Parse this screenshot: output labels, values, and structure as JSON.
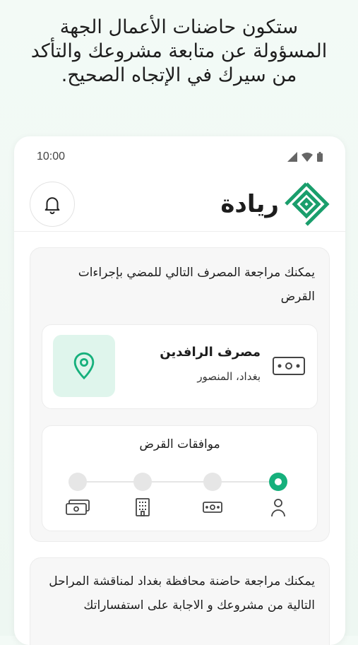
{
  "headline": "ستكون حاضنات الأعمال الجهة المسؤولة عن متابعة مشروعك والتأكد من سيرك في الإتجاه الصحيح.",
  "status": {
    "time": "10:00"
  },
  "app": {
    "logo_text": "ريادة"
  },
  "card1": {
    "intro": "يمكنك مراجعة المصرف التالي للمضي بإجراءات القرض",
    "bank_name": "مصرف الرافدين",
    "bank_location": "بغداد، المنصور",
    "steps_title": "موافقات القرض",
    "steps": [
      {
        "icon": "person-icon",
        "active": true
      },
      {
        "icon": "cash-icon",
        "active": false
      },
      {
        "icon": "building-icon",
        "active": false
      },
      {
        "icon": "money-stack-icon",
        "active": false
      }
    ]
  },
  "card2": {
    "text": "يمكنك مراجعة حاضنة محافظة بغداد لمناقشة المراحل التالية من مشروعك و الاجابة على استفساراتك"
  },
  "colors": {
    "accent": "#16b07c",
    "accent_light": "#dff5ec",
    "logo_green": "#1a9e6c"
  }
}
